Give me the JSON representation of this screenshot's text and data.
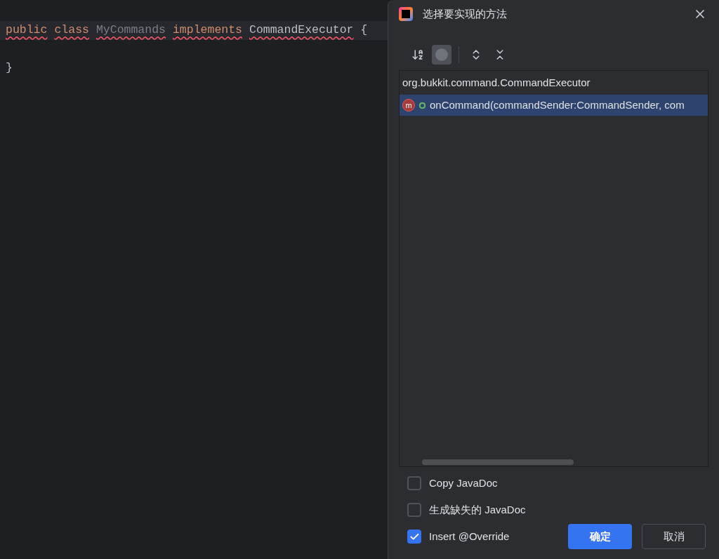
{
  "editor": {
    "lines": [
      {
        "current": true,
        "tokens": [
          {
            "kind": "keyword",
            "text": "public",
            "error": true
          },
          {
            "kind": "keyword",
            "text": "class",
            "error": true
          },
          {
            "kind": "unused",
            "text": "MyCommands",
            "error": true
          },
          {
            "kind": "keyword",
            "text": "implements",
            "error": true
          },
          {
            "kind": "plain",
            "text": "CommandExecutor",
            "error": true
          },
          {
            "kind": "plain",
            "text": "{",
            "error": false
          }
        ]
      },
      {
        "current": false
      },
      {
        "current": false,
        "tokens": [
          {
            "kind": "plain",
            "text": "}",
            "error": false
          }
        ]
      }
    ]
  },
  "dialog": {
    "title": "选择要实现的方法",
    "toolbar": [
      {
        "kind": "sort",
        "selected": false
      },
      {
        "kind": "dot",
        "selected": true
      },
      {
        "kind": "expand",
        "selected": false
      },
      {
        "kind": "collapse",
        "selected": false
      }
    ],
    "tree": {
      "group": "org.bukkit.command.CommandExecutor",
      "children": [
        {
          "icon_letter": "m",
          "label": "onCommand(commandSender:CommandSender, com",
          "selected": true
        }
      ]
    },
    "options": [
      {
        "label": "Copy JavaDoc",
        "checked": false
      },
      {
        "label": "生成缺失的 JavaDoc",
        "checked": false
      },
      {
        "label": "Insert @Override",
        "checked": true
      }
    ],
    "buttons": [
      {
        "label": "确定",
        "kind": "primary"
      },
      {
        "label": "取消",
        "kind": "secondary"
      }
    ]
  }
}
